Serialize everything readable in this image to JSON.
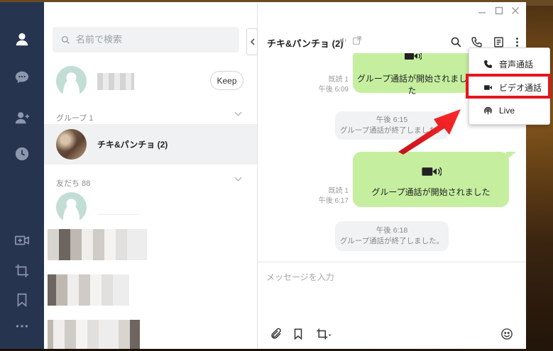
{
  "search": {
    "placeholder": "名前で検索"
  },
  "profile": {
    "keep_label": "Keep"
  },
  "sections": {
    "groups_label": "グループ 1",
    "friends_label": "友だち 88"
  },
  "group": {
    "name": "チキ&パンチョ (2)"
  },
  "chat": {
    "title": "チキ&パンチョ (2)",
    "messages": [
      {
        "type": "outgoing",
        "text": "グループ通話が開始されました",
        "read": "既読 1",
        "time": "午後 6:09"
      },
      {
        "type": "system",
        "time": "午後 6:15",
        "text": "グループ通話が終了しました。"
      },
      {
        "type": "outgoing",
        "text": "グループ通話が開始されました",
        "read": "既読 1",
        "time": "午後 6:17"
      },
      {
        "type": "system",
        "time": "午後 6:18",
        "text": "グループ通話が終了しました。"
      }
    ],
    "input_placeholder": "メッセージを入力"
  },
  "call_menu": {
    "items": [
      {
        "label": "音声通話",
        "icon": "phone-icon"
      },
      {
        "label": "ビデオ通話",
        "icon": "video-camera-icon"
      },
      {
        "label": "Live",
        "icon": "live-broadcast-icon"
      }
    ],
    "highlighted": "ビデオ通話"
  },
  "colors": {
    "rail": "#26344f",
    "bubble": "#c5ef9f",
    "highlight": "#e8141d"
  }
}
